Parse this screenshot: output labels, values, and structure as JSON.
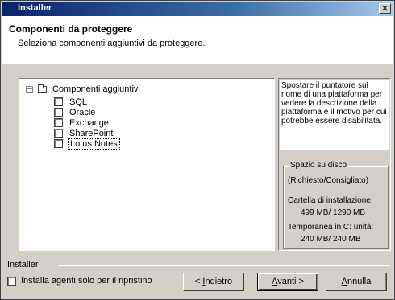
{
  "window": {
    "title": "Installer",
    "close_glyph": "✕"
  },
  "header": {
    "title": "Componenti da proteggere",
    "subtitle": "Seleziona componenti aggiuntivi da proteggere."
  },
  "tree": {
    "root_label": "Componenti aggiuntivi",
    "expander_glyph": "−",
    "items": [
      {
        "label": "SQL",
        "checked": false
      },
      {
        "label": "Oracle",
        "checked": false
      },
      {
        "label": "Exchange",
        "checked": false
      },
      {
        "label": "SharePoint",
        "checked": false
      },
      {
        "label": "Lotus Notes",
        "checked": false,
        "focused": true
      }
    ]
  },
  "description": {
    "text": "Spostare il puntatore sul nome di una piattaforma per vedere la descrizione della piattaforma e il motivo per cui potrebbe essere disabilitata."
  },
  "disk_space": {
    "legend": "Spazio su disco",
    "columns": "(Richiesto/Consigliato)",
    "install_folder_label": "Cartella di installazione:",
    "install_folder_value": "499 MB/ 1290 MB",
    "temp_label": "Temporanea in C: unità:",
    "temp_value": "240 MB/ 240 MB"
  },
  "footer": {
    "group_label": "Installer",
    "restore_only_label": "Installa agenti solo per il ripristino",
    "restore_only_checked": false,
    "back_prefix": "< ",
    "back_accel": "I",
    "back_rest": "ndietro",
    "next_accel": "A",
    "next_rest": "vanti >",
    "cancel_accel": "A",
    "cancel_rest": "nnulla"
  }
}
